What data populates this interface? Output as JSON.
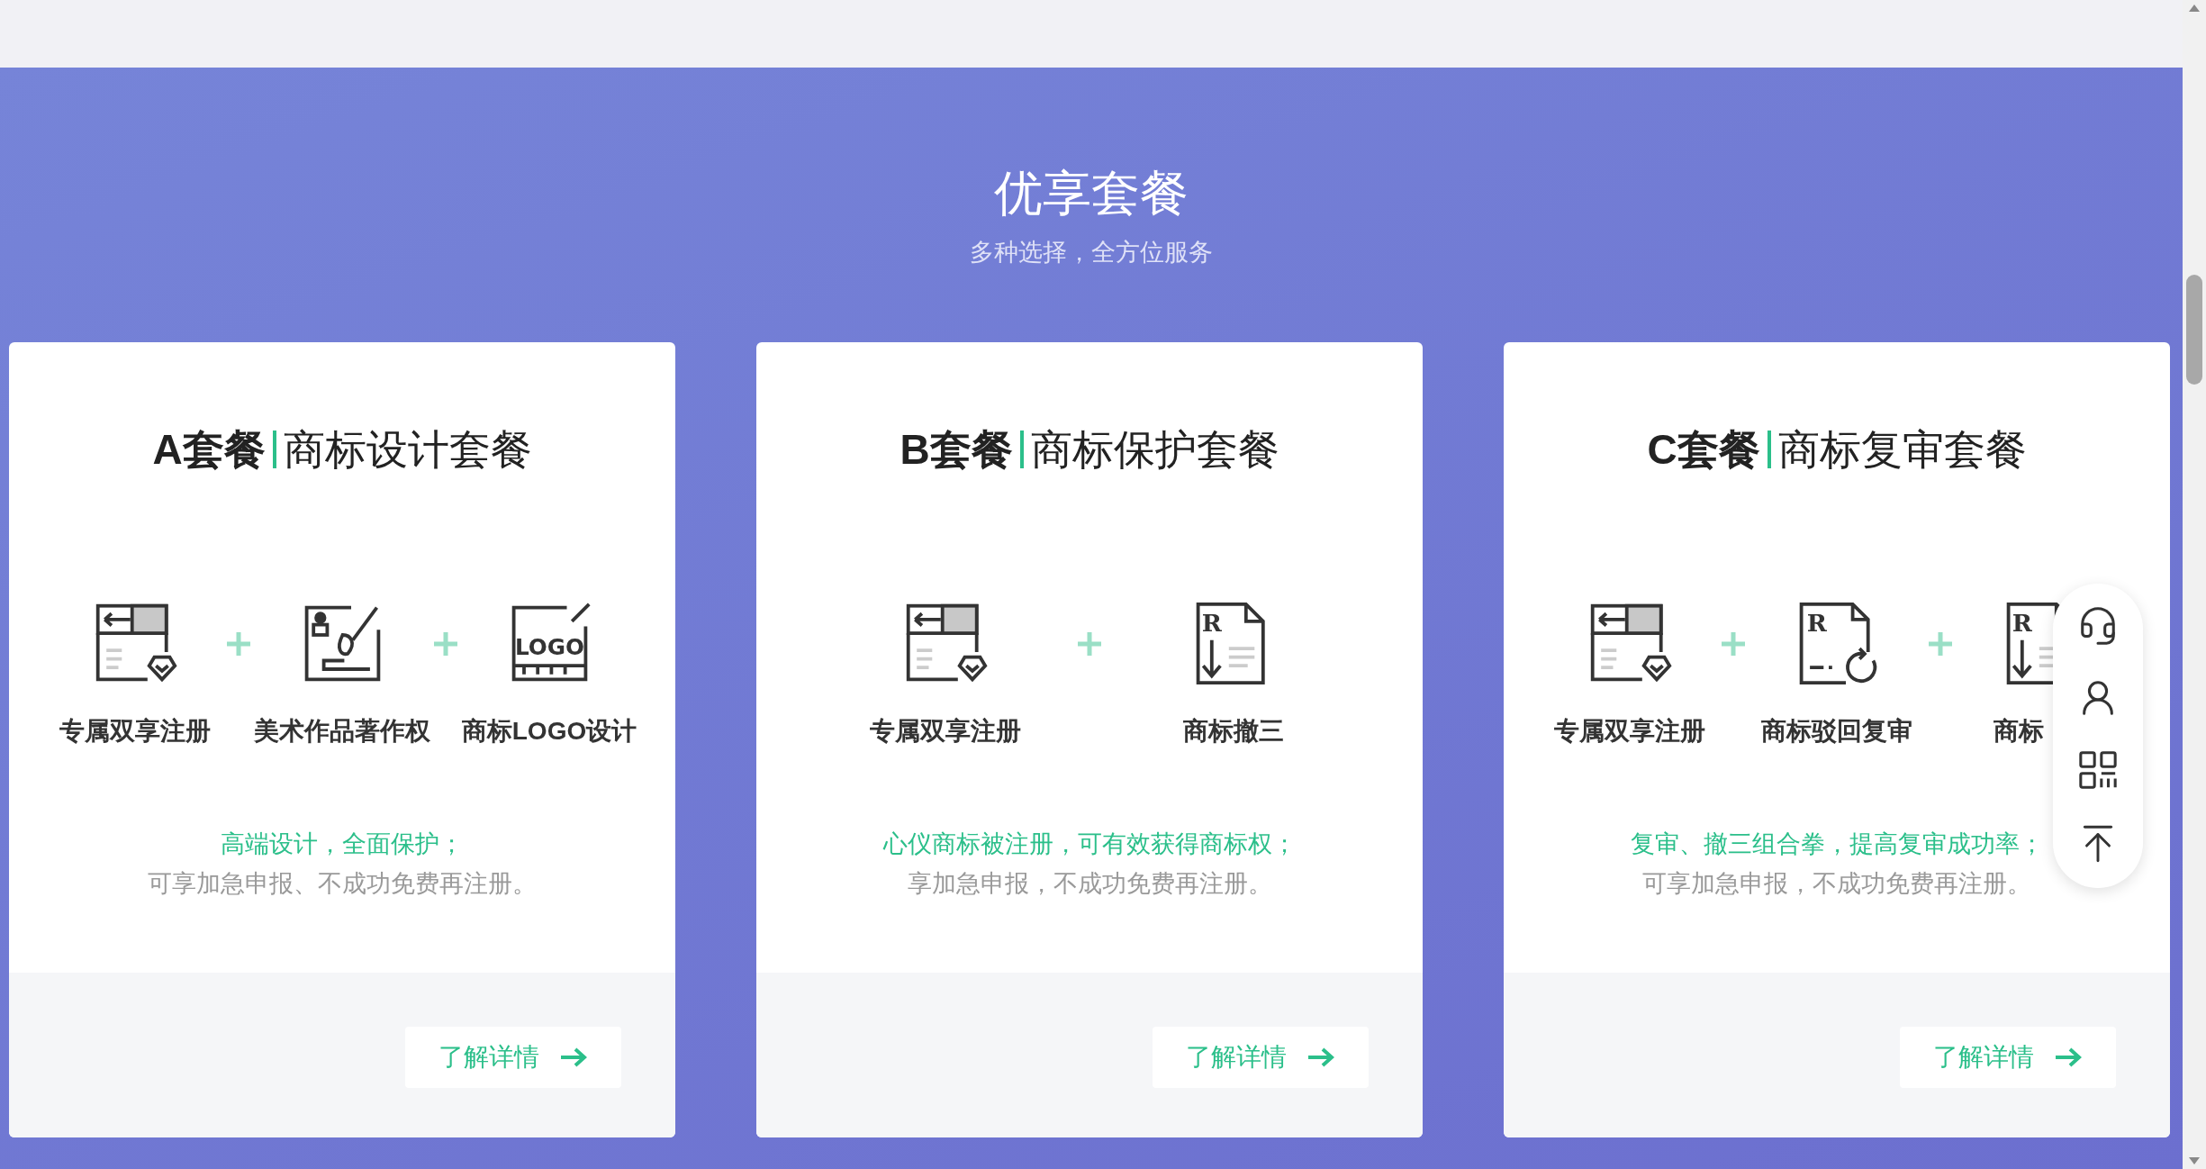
{
  "section": {
    "title": "优享套餐",
    "subtitle": "多种选择，全方位服务"
  },
  "packages": [
    {
      "code": "A套餐",
      "name": "商标设计套餐",
      "items": [
        {
          "kind": "register",
          "label": "专属双享注册"
        },
        {
          "kind": "copyright",
          "label": "美术作品著作权"
        },
        {
          "kind": "logo",
          "label": "商标LOGO设计",
          "icon_text": "LOGO"
        }
      ],
      "highlight": "高端设计，全面保护；",
      "note": "可享加急申报、不成功免费再注册。",
      "button": "了解详情"
    },
    {
      "code": "B套餐",
      "name": "商标保护套餐",
      "items": [
        {
          "kind": "register",
          "label": "专属双享注册"
        },
        {
          "kind": "withdraw",
          "label": "商标撤三",
          "icon_text": "R"
        }
      ],
      "highlight": "心仪商标被注册，可有效获得商标权；",
      "note": "享加急申报，不成功免费再注册。",
      "button": "了解详情"
    },
    {
      "code": "C套餐",
      "name": "商标复审套餐",
      "items": [
        {
          "kind": "register",
          "label": "专属双享注册"
        },
        {
          "kind": "review",
          "label": "商标驳回复审",
          "icon_text": "R"
        },
        {
          "kind": "withdraw",
          "label": "商标",
          "icon_text": "R"
        }
      ],
      "highlight": "复审、撤三组合拳，提高复审成功率；",
      "note": "可享加急申报，不成功免费再注册。",
      "button": "了解详情"
    }
  ],
  "float_toolbar": [
    {
      "kind": "support"
    },
    {
      "kind": "user"
    },
    {
      "kind": "qr"
    },
    {
      "kind": "top"
    }
  ]
}
